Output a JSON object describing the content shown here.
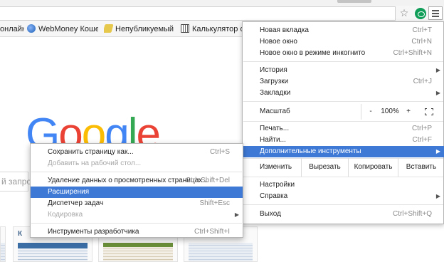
{
  "toolbar": {
    "star_glyph": "☆",
    "menu_icon": "hamburger-menu-icon",
    "extension_icon": "eye-extension-icon",
    "accent": "#3e79d6"
  },
  "bookmarks": [
    {
      "label": "онлайн",
      "icon": "page-icon"
    },
    {
      "label": "WebMoney Кошелё",
      "icon": "globe-icon"
    },
    {
      "label": "Непубликуемый ли",
      "icon": "pen-icon"
    },
    {
      "label": "Калькулятор онла",
      "icon": "calculator-icon"
    }
  ],
  "page": {
    "logo": [
      "G",
      "o",
      "o",
      "g",
      "l",
      "e"
    ],
    "search_placeholder": "й запрос",
    "vk_label": "К"
  },
  "menu": {
    "new_tab": {
      "label": "Новая вкладка",
      "shortcut": "Ctrl+T"
    },
    "new_window": {
      "label": "Новое окно",
      "shortcut": "Ctrl+N"
    },
    "incognito": {
      "label": "Новое окно в режиме инкогнито",
      "shortcut": "Ctrl+Shift+N"
    },
    "history": {
      "label": "История"
    },
    "downloads": {
      "label": "Загрузки",
      "shortcut": "Ctrl+J"
    },
    "bookmarks": {
      "label": "Закладки"
    },
    "zoom": {
      "label": "Масштаб",
      "minus": "-",
      "value": "100%",
      "plus": "+"
    },
    "print": {
      "label": "Печать...",
      "shortcut": "Ctrl+P"
    },
    "find": {
      "label": "Найти...",
      "shortcut": "Ctrl+F"
    },
    "more_tools": {
      "label": "Дополнительные инструменты"
    },
    "edit": {
      "label": "Изменить",
      "cut": "Вырезать",
      "copy": "Копировать",
      "paste": "Вставить"
    },
    "settings": {
      "label": "Настройки"
    },
    "help": {
      "label": "Справка"
    },
    "exit": {
      "label": "Выход",
      "shortcut": "Ctrl+Shift+Q"
    }
  },
  "submenu": {
    "save_page": {
      "label": "Сохранить страницу как...",
      "shortcut": "Ctrl+S"
    },
    "add_desktop": {
      "label": "Добавить на рабочий стол..."
    },
    "clear_data": {
      "label": "Удаление данных о просмотренных страницах...",
      "shortcut": "Ctrl+Shift+Del"
    },
    "extensions": {
      "label": "Расширения"
    },
    "task_manager": {
      "label": "Диспетчер задач",
      "shortcut": "Shift+Esc"
    },
    "encoding": {
      "label": "Кодировка"
    },
    "dev_tools": {
      "label": "Инструменты разработчика",
      "shortcut": "Ctrl+Shift+I"
    }
  }
}
